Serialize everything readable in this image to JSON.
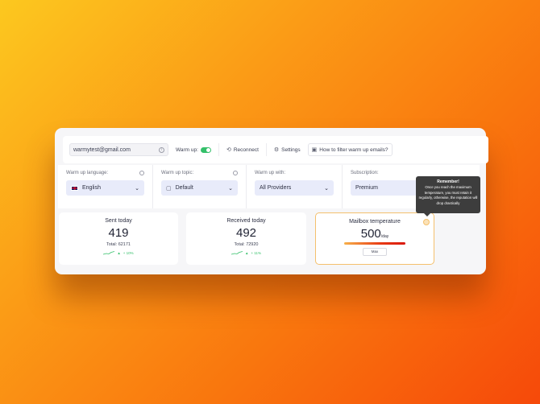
{
  "toolbar": {
    "email": "warmytest@gmail.com",
    "warmup_label": "Warm up:",
    "reconnect_label": "Reconnect",
    "settings_label": "Settings",
    "help_label": "How to filter warm up emails?"
  },
  "filters": {
    "language_label": "Warm up language:",
    "language_value": "English",
    "topic_label": "Warm up topic:",
    "topic_value": "Default",
    "with_label": "Warm up with:",
    "with_value": "All Providers",
    "subscription_label": "Subscription:",
    "subscription_value": "Premium"
  },
  "stats": {
    "sent": {
      "title": "Sent today",
      "value": "419",
      "total": "Total: 62171",
      "trend": "+ 10%"
    },
    "received": {
      "title": "Received today",
      "value": "492",
      "total": "Total: 72920",
      "trend": "+ 11%"
    },
    "temperature": {
      "title": "Mailbox temperature",
      "value": "500",
      "unit": "/day",
      "max_label": "Max"
    }
  },
  "tooltip": {
    "title": "Remember!",
    "body": "Once you reach the maximum temperature, you must retain it regularly, otherwise, the reputation will drop drastically"
  },
  "colors": {
    "toggle_on": "#34c06a",
    "accent_select": "#e8ebfa",
    "trend_green": "#34c06a"
  }
}
